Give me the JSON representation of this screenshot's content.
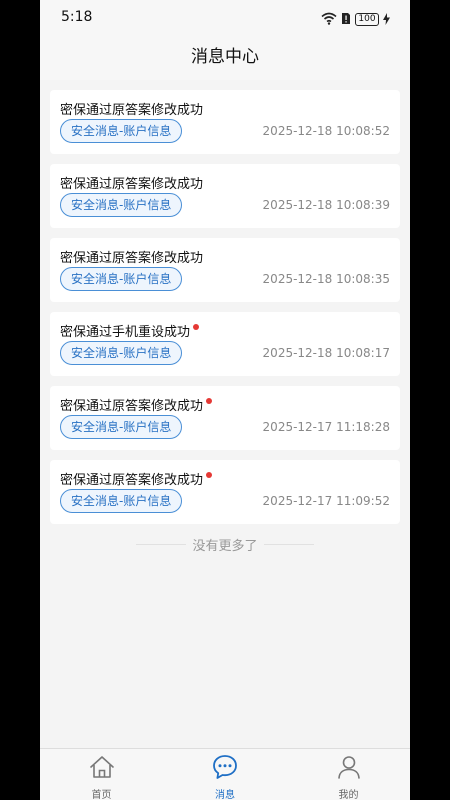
{
  "status_bar": {
    "time": "5:18",
    "battery": "100"
  },
  "header": {
    "title": "消息中心"
  },
  "messages": [
    {
      "title": "密保通过原答案修改成功",
      "tag": "安全消息-账户信息",
      "time": "2025-12-18 10:08:52",
      "unread": false
    },
    {
      "title": "密保通过原答案修改成功",
      "tag": "安全消息-账户信息",
      "time": "2025-12-18 10:08:39",
      "unread": false
    },
    {
      "title": "密保通过原答案修改成功",
      "tag": "安全消息-账户信息",
      "time": "2025-12-18 10:08:35",
      "unread": false
    },
    {
      "title": "密保通过手机重设成功",
      "tag": "安全消息-账户信息",
      "time": "2025-12-18 10:08:17",
      "unread": true
    },
    {
      "title": "密保通过原答案修改成功",
      "tag": "安全消息-账户信息",
      "time": "2025-12-17 11:18:28",
      "unread": true
    },
    {
      "title": "密保通过原答案修改成功",
      "tag": "安全消息-账户信息",
      "time": "2025-12-17 11:09:52",
      "unread": true
    }
  ],
  "footer": {
    "no_more": "没有更多了"
  },
  "tabbar": {
    "items": [
      {
        "label": "首页",
        "icon": "home-icon"
      },
      {
        "label": "消息",
        "icon": "chat-bubble-icon"
      },
      {
        "label": "我的",
        "icon": "user-icon"
      }
    ],
    "active_index": 1
  },
  "colors": {
    "accent": "#1f6fc5",
    "unread": "#e53935",
    "tag_border": "#4a8fd6"
  }
}
